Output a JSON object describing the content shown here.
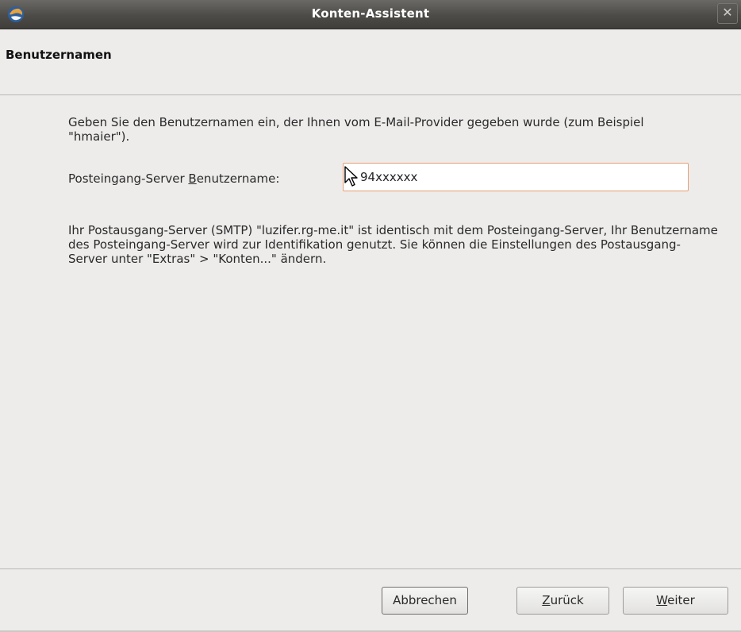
{
  "window": {
    "title": "Konten-Assistent",
    "close_label": "✕"
  },
  "page": {
    "title": "Benutzernamen"
  },
  "intro_text": "Geben Sie den Benutzernamen ein, der Ihnen vom E-Mail-Provider gegeben wurde (zum Beispiel \"hmaier\").",
  "field": {
    "label_prefix": "Posteingang-Server ",
    "label_mnemonic": "B",
    "label_suffix": "enutzername:",
    "value": "94xxxxxx"
  },
  "note_text": "Ihr Postausgang-Server (SMTP) \"luzifer.rg-me.it\" ist identisch mit dem Posteingang-Server, Ihr Benutzername des Posteingang-Server wird zur Identifikation genutzt. Sie können die Einstellungen des Postausgang-Server unter \"Extras\" > \"Konten...\" ändern.",
  "buttons": {
    "cancel": "Abbrechen",
    "back_mnemonic": "Z",
    "back_rest": "urück",
    "next_mnemonic": "W",
    "next_rest": "eiter"
  }
}
